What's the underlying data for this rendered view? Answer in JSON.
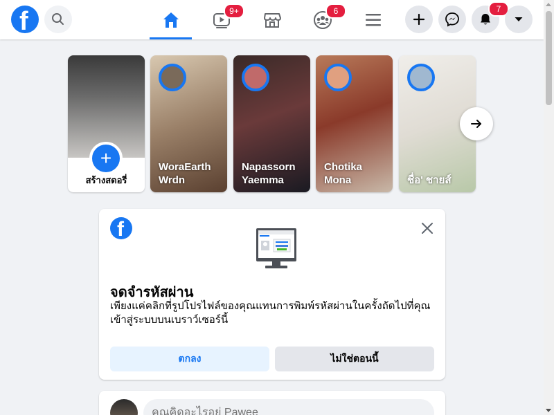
{
  "topbar": {
    "logo_letter": "f",
    "nav": {
      "home": {
        "label": "Home"
      },
      "watch": {
        "badge": "9+"
      },
      "marketplace": {},
      "groups": {
        "badge": "6"
      },
      "menu": {}
    },
    "notifications_badge": "7"
  },
  "stories": {
    "create_label": "สร้างสตอรี่",
    "items": [
      {
        "name": "WoraEarth Wrdn"
      },
      {
        "name": "Napassorn Yaemma"
      },
      {
        "name": "Chotika Mona"
      },
      {
        "name": "ชื่อ' ชายส์"
      }
    ]
  },
  "remember_card": {
    "title": "จดจำรหัสผ่าน",
    "description": "เพียงแค่คลิกที่รูปโปรไฟล์ของคุณแทนการพิมพ์รหัสผ่านในครั้งถัดไปที่คุณเข้าสู่ระบบบนเบราว์เซอร์นี้",
    "ok_label": "ตกลง",
    "not_now_label": "ไม่ใช่ตอนนี้"
  },
  "composer": {
    "placeholder": "คุณคิดอะไรอยู่ Pawee"
  },
  "colors": {
    "brand": "#1877f2",
    "badge": "#e41e3f",
    "background": "#f0f2f5"
  }
}
